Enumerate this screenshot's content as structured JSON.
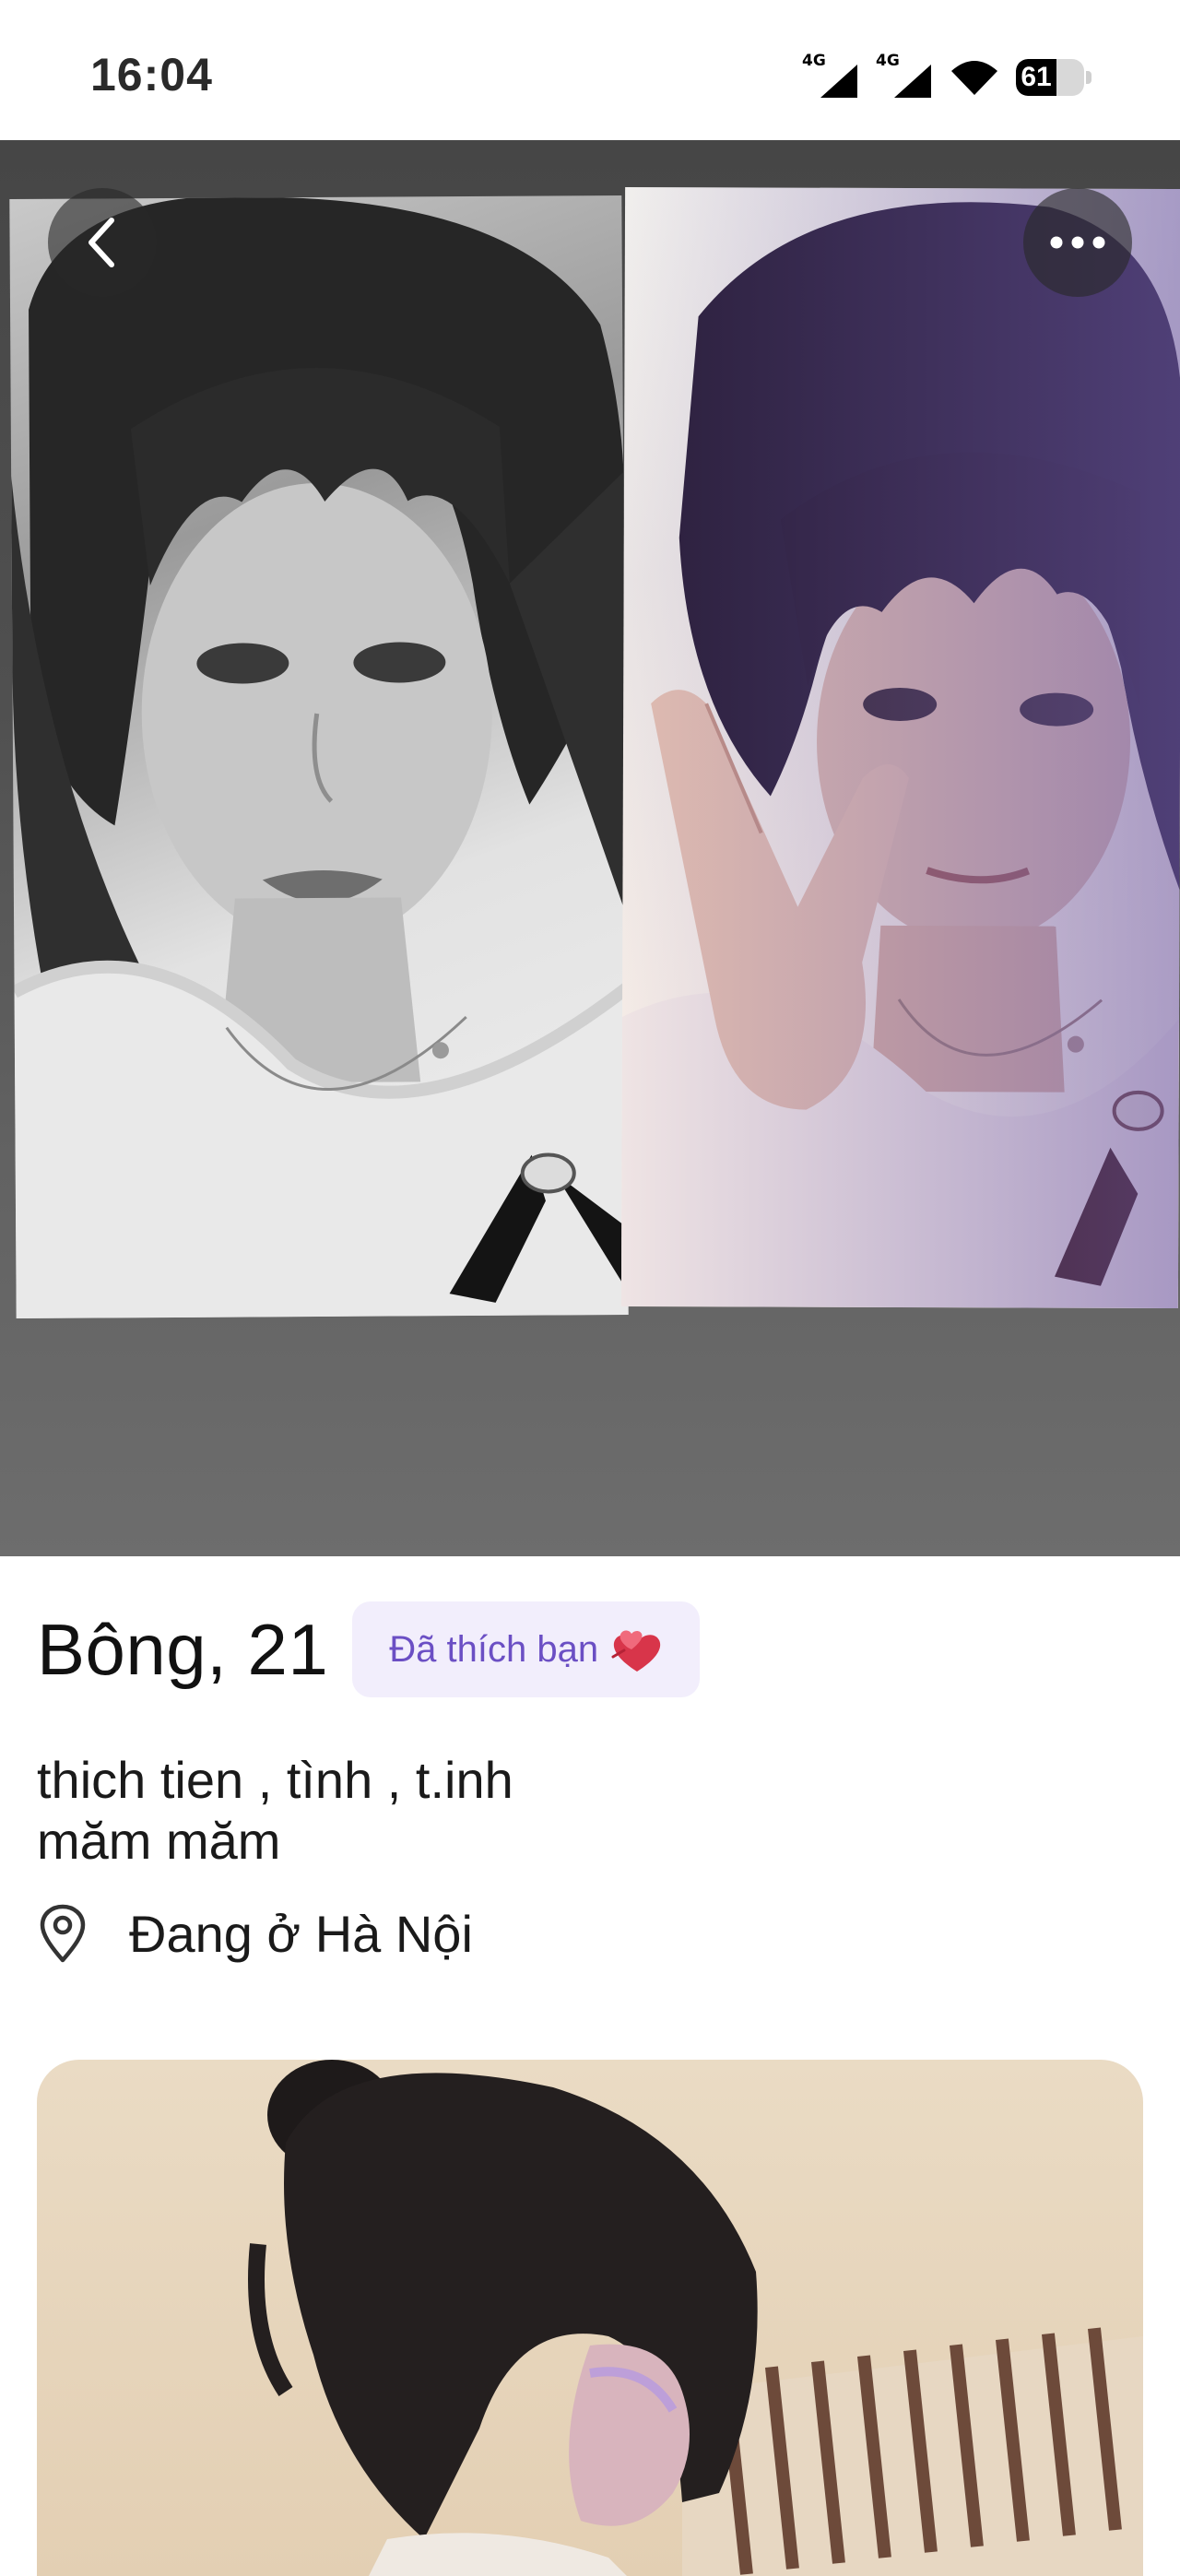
{
  "status_bar": {
    "time": "16:04",
    "signal_1_label": "4G",
    "signal_2_label": "4G",
    "battery_level": "61"
  },
  "header": {
    "back_icon": "chevron-left-icon",
    "more_icon": "more-horizontal-icon"
  },
  "profile": {
    "name_age": "Bông, 21",
    "liked_badge": "Đã thích bạn",
    "liked_icon": "two-hearts-icon",
    "bio": "thich tien , tình , t.inh\nmăm măm",
    "location_icon": "map-pin-icon",
    "location": "Đang ở Hà Nội"
  },
  "colors": {
    "badge_background": "#f2eefc",
    "badge_text": "#6b4fc4",
    "hero_background": "#505050"
  }
}
